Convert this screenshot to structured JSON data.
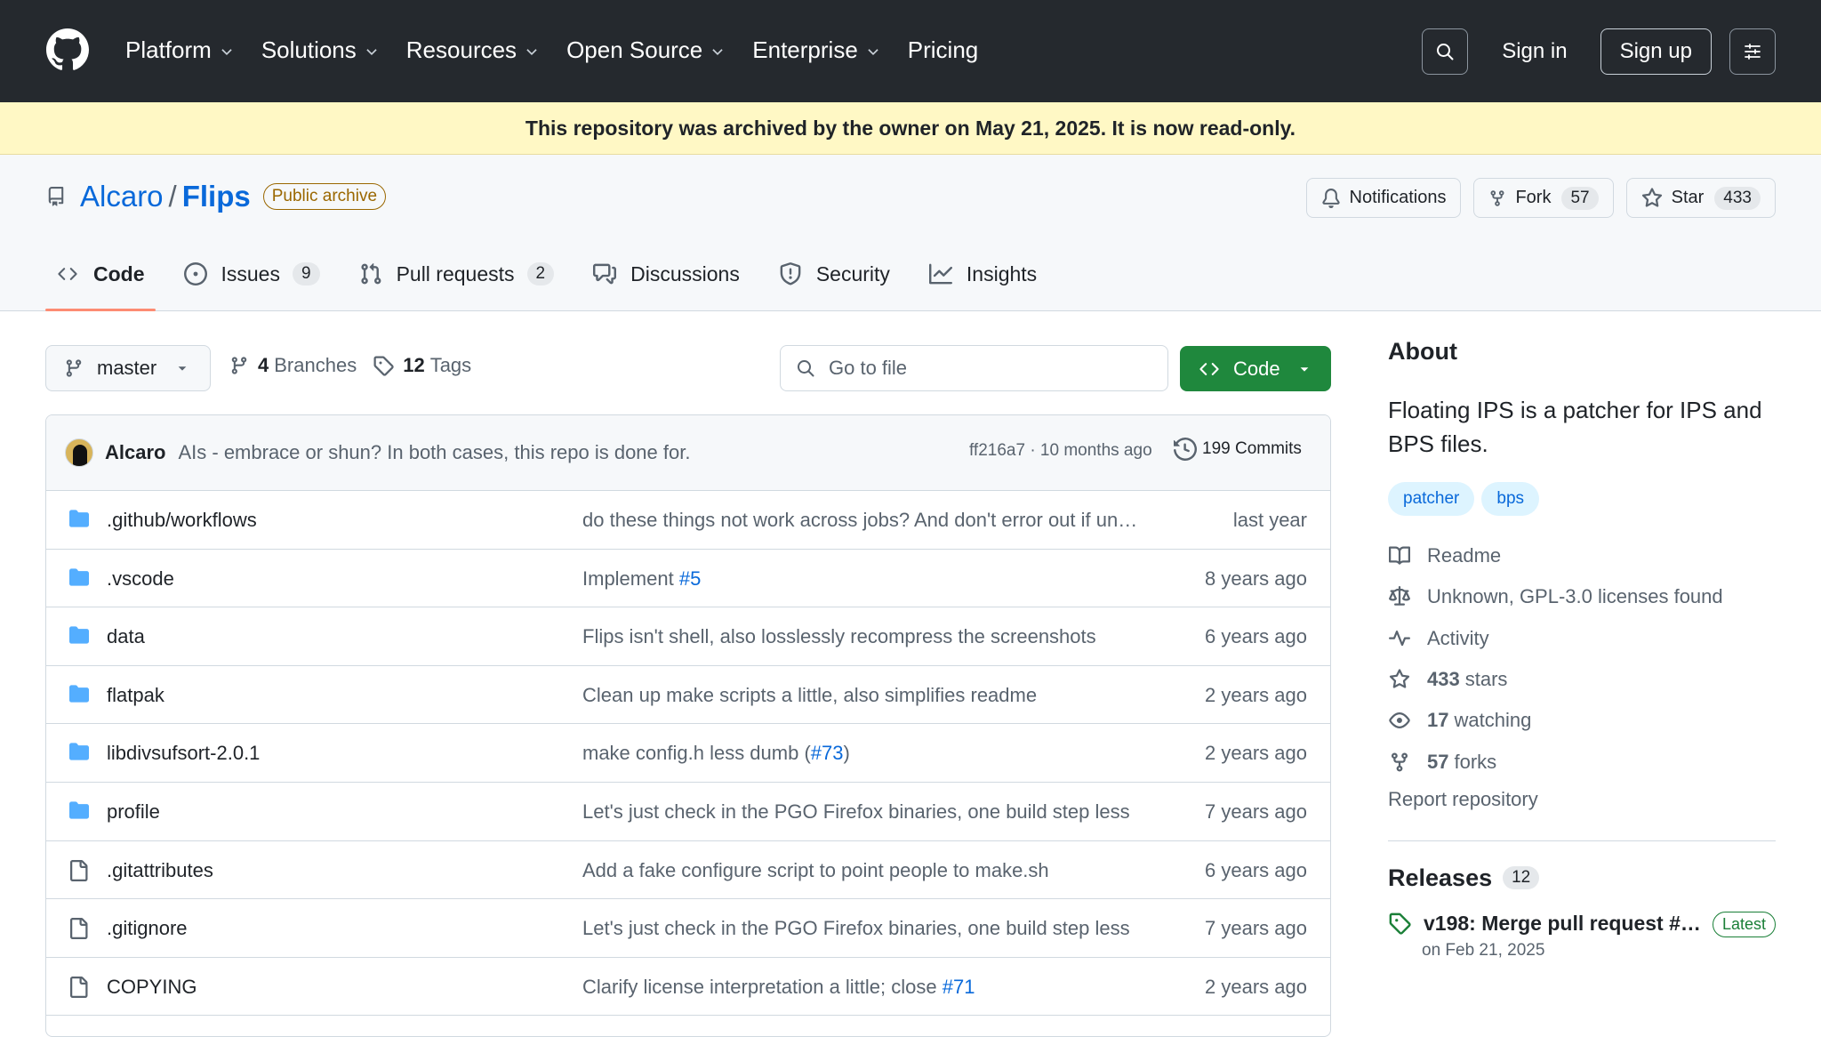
{
  "header": {
    "nav": [
      {
        "label": "Platform",
        "chevron": true
      },
      {
        "label": "Solutions",
        "chevron": true
      },
      {
        "label": "Resources",
        "chevron": true
      },
      {
        "label": "Open Source",
        "chevron": true
      },
      {
        "label": "Enterprise",
        "chevron": true
      },
      {
        "label": "Pricing",
        "chevron": false
      }
    ],
    "sign_in": "Sign in",
    "sign_up": "Sign up"
  },
  "banner": {
    "text": "This repository was archived by the owner on May 21, 2025. It is now read-only."
  },
  "repo": {
    "owner": "Alcaro",
    "separator": "/",
    "name": "Flips",
    "visibility": "Public archive",
    "notifications_label": "Notifications",
    "fork_label": "Fork",
    "fork_count": "57",
    "star_label": "Star",
    "star_count": "433"
  },
  "tabs": [
    {
      "label": "Code",
      "count": "",
      "icon": "code-icon",
      "active": true
    },
    {
      "label": "Issues",
      "count": "9",
      "icon": "issue-icon",
      "active": false
    },
    {
      "label": "Pull requests",
      "count": "2",
      "icon": "pull-request-icon",
      "active": false
    },
    {
      "label": "Discussions",
      "count": "",
      "icon": "discussions-icon",
      "active": false
    },
    {
      "label": "Security",
      "count": "",
      "icon": "shield-icon",
      "active": false
    },
    {
      "label": "Insights",
      "count": "",
      "icon": "graph-icon",
      "active": false
    }
  ],
  "toolbar": {
    "branch": "master",
    "branches_count": "4",
    "branches_label": "Branches",
    "tags_count": "12",
    "tags_label": "Tags",
    "goto_placeholder": "Go to file",
    "code_button": "Code"
  },
  "latest_commit": {
    "author": "Alcaro",
    "message": "AIs - embrace or shun? In both cases, this repo is done for.",
    "hash_time": "ff216a7 · 10 months ago",
    "commits": "199 Commits"
  },
  "files": [
    {
      "name": ".github/workflows",
      "type": "dir",
      "message": "do these things not work across jobs? And don't error out if un…",
      "link": "",
      "suffix": "",
      "age": "last year"
    },
    {
      "name": ".vscode",
      "type": "dir",
      "message": "Implement ",
      "link": "#5",
      "suffix": "",
      "age": "8 years ago"
    },
    {
      "name": "data",
      "type": "dir",
      "message": "Flips isn't shell, also losslessly recompress the screenshots",
      "link": "",
      "suffix": "",
      "age": "6 years ago"
    },
    {
      "name": "flatpak",
      "type": "dir",
      "message": "Clean up make scripts a little, also simplifies readme",
      "link": "",
      "suffix": "",
      "age": "2 years ago"
    },
    {
      "name": "libdivsufsort-2.0.1",
      "type": "dir",
      "message": "make config.h less dumb (",
      "link": "#73",
      "suffix": ")",
      "age": "2 years ago"
    },
    {
      "name": "profile",
      "type": "dir",
      "message": "Let's just check in the PGO Firefox binaries, one build step less",
      "link": "",
      "suffix": "",
      "age": "7 years ago"
    },
    {
      "name": ".gitattributes",
      "type": "file",
      "message": "Add a fake configure script to point people to make.sh",
      "link": "",
      "suffix": "",
      "age": "6 years ago"
    },
    {
      "name": ".gitignore",
      "type": "file",
      "message": "Let's just check in the PGO Firefox binaries, one build step less",
      "link": "",
      "suffix": "",
      "age": "7 years ago"
    },
    {
      "name": "COPYING",
      "type": "file",
      "message": "Clarify license interpretation a little; close ",
      "link": "#71",
      "suffix": "",
      "age": "2 years ago"
    }
  ],
  "about": {
    "heading": "About",
    "description": "Floating IPS is a patcher for IPS and BPS files.",
    "topics": [
      "patcher",
      "bps"
    ],
    "items": [
      {
        "icon": "book-icon",
        "bold": "",
        "text": "Readme"
      },
      {
        "icon": "law-icon",
        "bold": "",
        "text": "Unknown, GPL-3.0 licenses found"
      },
      {
        "icon": "pulse-icon",
        "bold": "",
        "text": "Activity"
      },
      {
        "icon": "star-icon",
        "bold": "433",
        "text": "stars"
      },
      {
        "icon": "eye-icon",
        "bold": "17",
        "text": "watching"
      },
      {
        "icon": "fork-icon",
        "bold": "57",
        "text": "forks"
      }
    ],
    "report": "Report repository"
  },
  "releases": {
    "heading": "Releases",
    "count": "12",
    "latest_title": "v198: Merge pull request #…",
    "latest_badge": "Latest",
    "latest_date": "on Feb 21, 2025"
  },
  "colors": {
    "header_bg": "#25292e",
    "banner_bg": "#fff8c5",
    "accent": "#0969da",
    "green": "#1f883d",
    "tab_underline": "#fd8c73",
    "folder": "#54aeff"
  }
}
